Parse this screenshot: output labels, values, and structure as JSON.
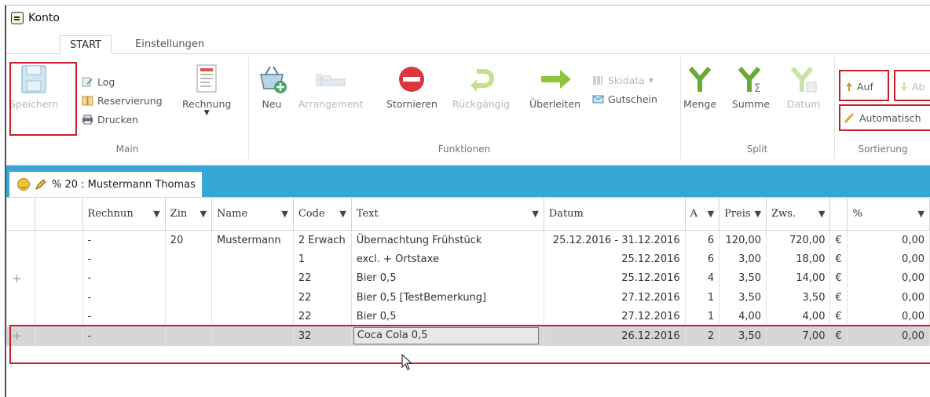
{
  "window": {
    "title": "Konto"
  },
  "ribbon_tabs": [
    "START",
    "Einstellungen"
  ],
  "ribbon": {
    "main": {
      "label": "Main",
      "save": "Speichern",
      "log": "Log",
      "reservation": "Reservierung",
      "print": "Drucken",
      "invoice": "Rechnung"
    },
    "functions": {
      "label": "Funktionen",
      "new": "Neu",
      "arrangement": "Arrangement",
      "cancel": "Stornieren",
      "undo": "Rückgängig",
      "transfer": "Überleiten",
      "skidata": "Skidata",
      "voucher": "Gutschein"
    },
    "split": {
      "label": "Split",
      "quantity": "Menge",
      "sum": "Summe",
      "date": "Datum"
    },
    "sort": {
      "label": "Sortierung",
      "asc": "Auf",
      "desc": "Ab",
      "auto": "Automatisch"
    }
  },
  "doc_tab": {
    "label": "% 20 : Mustermann Thomas"
  },
  "grid": {
    "columns": [
      "Rechnun",
      "Zin",
      "Name",
      "Code",
      "Text",
      "Datum",
      "A",
      "Preis",
      "Zws.",
      "",
      "%"
    ],
    "rows": [
      {
        "expand": "",
        "rechnung": "-",
        "zimmer": "20",
        "name": "Mustermann",
        "code": "2 Erwach",
        "text": "Übernachtung Frühstück",
        "datum": "25.12.2016 - 31.12.2016",
        "anzahl": "6",
        "preis": "120,00",
        "zws": "720,00",
        "cur": "€",
        "pct": "0,00"
      },
      {
        "expand": "",
        "rechnung": "-",
        "zimmer": "",
        "name": "",
        "code": "1",
        "text": "excl.  +  Ortstaxe",
        "datum": "25.12.2016",
        "anzahl": "6",
        "preis": "3,00",
        "zws": "18,00",
        "cur": "€",
        "pct": "0,00"
      },
      {
        "expand": "+",
        "rechnung": "-",
        "zimmer": "",
        "name": "",
        "code": "22",
        "text": "Bier 0,5",
        "datum": "25.12.2016",
        "anzahl": "4",
        "preis": "3,50",
        "zws": "14,00",
        "cur": "€",
        "pct": "0,00"
      },
      {
        "expand": "",
        "rechnung": "-",
        "zimmer": "",
        "name": "",
        "code": "22",
        "text": "Bier 0,5 [TestBemerkung]",
        "datum": "27.12.2016",
        "anzahl": "1",
        "preis": "3,50",
        "zws": "3,50",
        "cur": "€",
        "pct": "0,00"
      },
      {
        "expand": "",
        "rechnung": "-",
        "zimmer": "",
        "name": "",
        "code": "22",
        "text": "Bier 0,5",
        "datum": "27.12.2016",
        "anzahl": "1",
        "preis": "4,00",
        "zws": "4,00",
        "cur": "€",
        "pct": "0,00"
      },
      {
        "expand": "+",
        "rechnung": "-",
        "zimmer": "",
        "name": "",
        "code": "32",
        "text": "Coca Cola 0,5",
        "datum": "26.12.2016",
        "anzahl": "2",
        "preis": "3,50",
        "zws": "7,00",
        "cur": "€",
        "pct": "0,00"
      }
    ]
  },
  "colors": {
    "accent": "#35a6d6",
    "highlight": "#c8202a",
    "selected_row": "#d6d6d6"
  }
}
